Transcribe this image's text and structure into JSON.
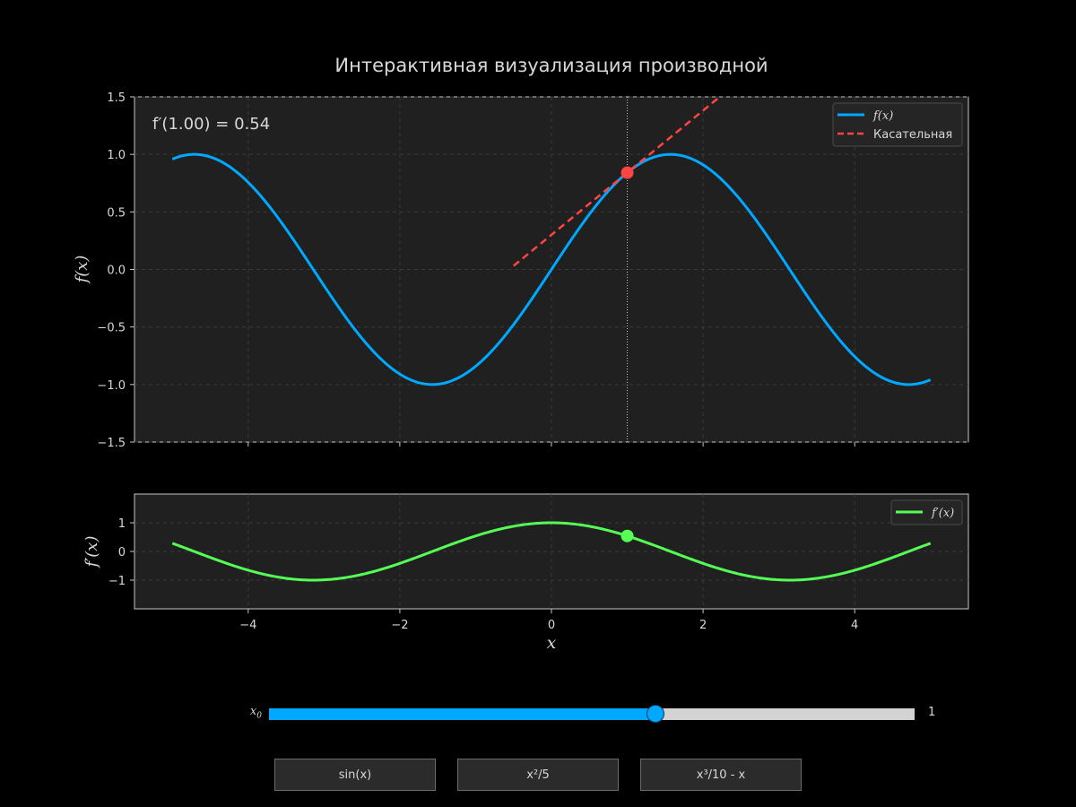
{
  "title": "Интерактивная визуализация производной",
  "chart_data": [
    {
      "type": "line",
      "xlim": [
        -5.5,
        5.5
      ],
      "ylim": [
        -1.5,
        1.5
      ],
      "xticks": [
        -4,
        -2,
        0,
        2,
        4
      ],
      "yticks": [
        1.5,
        1.0,
        0.5,
        0.0,
        -0.5,
        -1.0,
        -1.5
      ],
      "ytick_labels": [
        "1.5",
        "1.0",
        "0.5",
        "0.0",
        "−0.5",
        "−1.0",
        "−1.5"
      ],
      "ylabel": "f(x)",
      "grid": true,
      "annotation": "f′(1.00) = 0.54",
      "legend": {
        "placement": "top-right",
        "entries": [
          "f(x)",
          "Касательная"
        ]
      },
      "series": [
        {
          "name": "f(x)",
          "function": "sin(x)",
          "x_range": [
            -5,
            5
          ],
          "color": "#00a8ff"
        },
        {
          "name": "Касательная",
          "style": "dashed",
          "x_range": [
            -0.5,
            2.2
          ],
          "point": [
            1.0,
            0.841
          ],
          "slope": 0.54,
          "color": "#ff4444"
        }
      ],
      "marker": {
        "x": 1.0,
        "y": 0.841,
        "color": "#ff4444"
      },
      "vline_x": 1.0
    },
    {
      "type": "line",
      "xlim": [
        -5.5,
        5.5
      ],
      "ylim": [
        -2.0,
        2.0
      ],
      "xticks": [
        -4,
        -2,
        0,
        2,
        4
      ],
      "xtick_labels": [
        "−4",
        "−2",
        "0",
        "2",
        "4"
      ],
      "yticks": [
        1,
        0,
        -1
      ],
      "ytick_labels": [
        "1",
        "0",
        "−1"
      ],
      "xlabel": "x",
      "ylabel": "f′(x)",
      "grid": true,
      "legend": {
        "placement": "top-right",
        "entries": [
          "f′(x)"
        ]
      },
      "series": [
        {
          "name": "f′(x)",
          "function": "cos(x)",
          "x_range": [
            -5,
            5
          ],
          "color": "#55ff55"
        }
      ],
      "marker": {
        "x": 1.0,
        "y": 0.54,
        "color": "#55ff55"
      }
    }
  ],
  "slider": {
    "label": "x",
    "label_sub": "0",
    "min": -5,
    "max": 5,
    "value": 1,
    "value_text": "1",
    "color": "#00a8ff"
  },
  "buttons": {
    "sin": "sin(x)",
    "square": "x²/5",
    "cubic": "x³/10 - x"
  }
}
